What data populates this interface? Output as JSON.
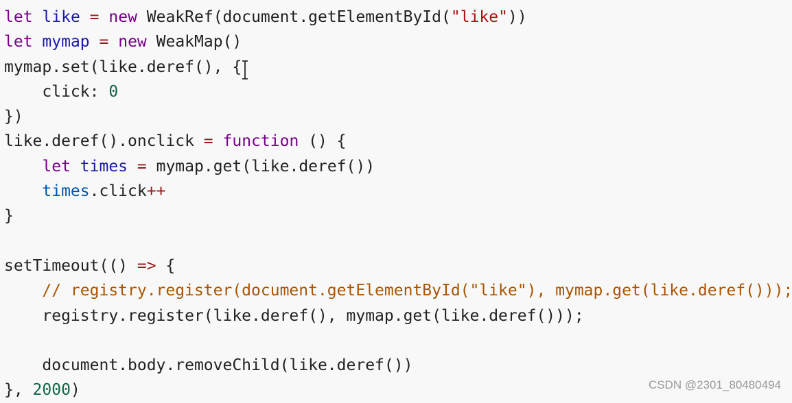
{
  "code_lines": [
    [
      [
        "let",
        "kw"
      ],
      [
        " ",
        "tx"
      ],
      [
        "like",
        "def"
      ],
      [
        " ",
        "tx"
      ],
      [
        "=",
        "op"
      ],
      [
        " ",
        "tx"
      ],
      [
        "new",
        "kw"
      ],
      [
        " WeakRef(document.getElementById(",
        "tx"
      ],
      [
        "\"like\"",
        "str"
      ],
      [
        "))",
        "tx"
      ]
    ],
    [
      [
        "let",
        "kw"
      ],
      [
        " ",
        "tx"
      ],
      [
        "mymap",
        "def"
      ],
      [
        " ",
        "tx"
      ],
      [
        "=",
        "op"
      ],
      [
        " ",
        "tx"
      ],
      [
        "new",
        "kw"
      ],
      [
        " WeakMap()",
        "tx"
      ]
    ],
    [
      [
        "mymap.set(like.deref(), {",
        "tx"
      ]
    ],
    [
      [
        "    click: ",
        "tx"
      ],
      [
        "0",
        "num"
      ]
    ],
    [
      [
        "})",
        "tx"
      ]
    ],
    [
      [
        "like.deref().onclick ",
        "tx"
      ],
      [
        "=",
        "op"
      ],
      [
        " ",
        "tx"
      ],
      [
        "function",
        "kw"
      ],
      [
        " () {",
        "tx"
      ]
    ],
    [
      [
        "    ",
        "tx"
      ],
      [
        "let",
        "kw"
      ],
      [
        " ",
        "tx"
      ],
      [
        "times",
        "def"
      ],
      [
        " ",
        "tx"
      ],
      [
        "=",
        "op"
      ],
      [
        " mymap.get(like.deref())",
        "tx"
      ]
    ],
    [
      [
        "    ",
        "tx"
      ],
      [
        "times",
        "v2"
      ],
      [
        ".click",
        "tx"
      ],
      [
        "++",
        "op"
      ]
    ],
    [
      [
        "}",
        "tx"
      ]
    ],
    [
      [
        "",
        "tx"
      ]
    ],
    [
      [
        "setTimeout(() ",
        "tx"
      ],
      [
        "=>",
        "op"
      ],
      [
        " {",
        "tx"
      ]
    ],
    [
      [
        "    ",
        "tx"
      ],
      [
        "// registry.register(document.getElementById(\"like\"), mymap.get(like.deref()));",
        "cm"
      ]
    ],
    [
      [
        "    registry.register(like.deref(), mymap.get(like.deref()));",
        "tx"
      ]
    ],
    [
      [
        "",
        "tx"
      ]
    ],
    [
      [
        "    document.body.removeChild(like.deref())",
        "tx"
      ]
    ],
    [
      [
        "}, ",
        "tx"
      ],
      [
        "2000",
        "num"
      ],
      [
        ")",
        "tx"
      ]
    ]
  ],
  "watermark": "CSDN @2301_80480494",
  "colors": {
    "background": "#f8f8f8",
    "keyword": "#770088",
    "definition": "#1a1aa6",
    "operator": "#981a1a",
    "number": "#116644",
    "string": "#aa1111",
    "comment": "#aa5500"
  }
}
